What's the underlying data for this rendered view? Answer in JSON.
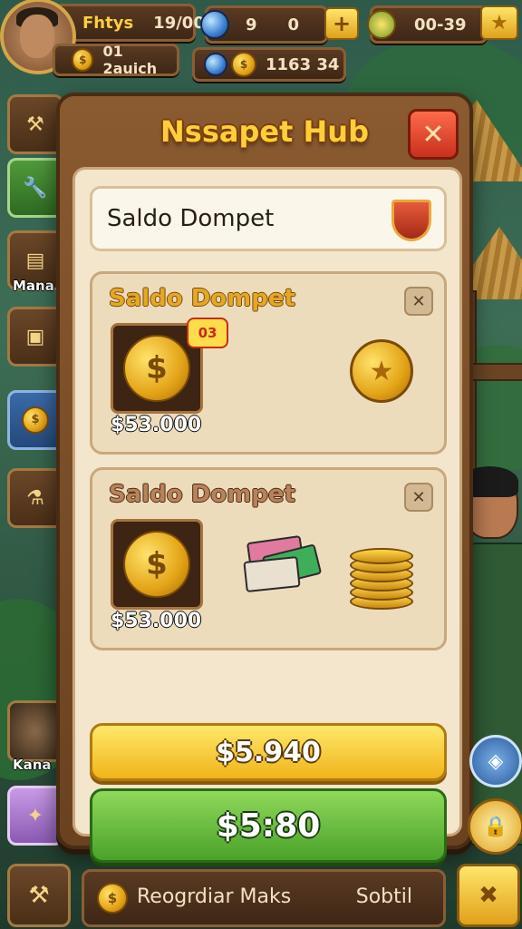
{
  "hud": {
    "player_name": "Fhtys",
    "player_value": "19/00",
    "sub_value": "01 2auich",
    "gems_left": "9",
    "gems_right": "0",
    "timer": "00-39",
    "center_value": "1163 34"
  },
  "side": {
    "label_1": "Mana",
    "label_2": "Kana"
  },
  "modal": {
    "title": "Nssapet Hub",
    "close_icon": "✕",
    "header_label": "Saldo Dompet",
    "cards": [
      {
        "title": "Saldo Dompet",
        "price": "$53.000",
        "badge": "03"
      },
      {
        "title": "Saldo Dompet",
        "price": "$53.000"
      }
    ],
    "buttons": {
      "yellow_label": "$5.940",
      "green_label": "$5:80"
    }
  },
  "bottom": {
    "left_text": "Reogrdiar Maks",
    "right_text": "Sobtil"
  },
  "icons": {
    "coin_symbol": "$",
    "star_symbol": "★",
    "plus_symbol": "+"
  },
  "colors": {
    "gold": "#ffcf3a",
    "panel": "#f3e6cc",
    "wood": "#8a5a30",
    "close_red": "#c8301c",
    "button_yellow": "#f0b41a",
    "button_green": "#4aa22a"
  }
}
